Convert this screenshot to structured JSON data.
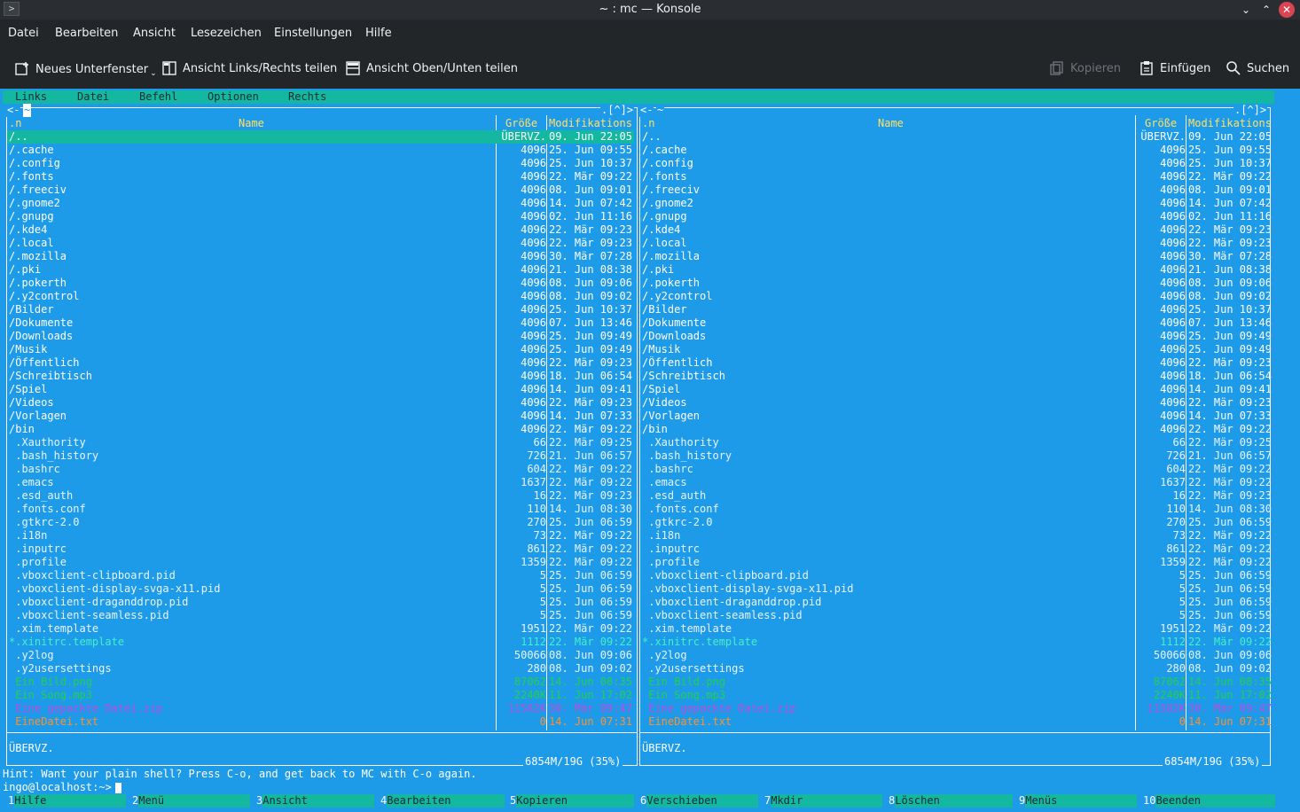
{
  "window": {
    "title": "~ : mc — Konsole",
    "app_icon": ">"
  },
  "menubar": [
    "Datei",
    "Bearbeiten",
    "Ansicht",
    "Lesezeichen",
    "Einstellungen",
    "Hilfe"
  ],
  "toolbar": {
    "new_tab": "Neues Unterfenster",
    "split_lr": "Ansicht Links/Rechts teilen",
    "split_tb": "Ansicht Oben/Unten teilen",
    "copy": "Kopieren",
    "paste": "Einfügen",
    "search": "Suchen"
  },
  "mc": {
    "menu": [
      "Links",
      "Datei",
      "Befehl",
      "Optionen",
      "Rechts"
    ],
    "columns": {
      "sort": ".n",
      "name": "Name",
      "size": "Größe",
      "date": "Modifikations"
    },
    "left_path": "~",
    "nav_left": "<-",
    "nav_right": ".[^]>",
    "status_selected": "ÜBERVZ.",
    "disk_info": "6854M/19G (35%)",
    "hint": "Hint: Want your plain shell? Press C-o, and get back to MC with C-o again.",
    "prompt": "ingo@localhost:~>",
    "files": [
      {
        "name": "/..",
        "size": "ÜBERVZ.",
        "date": "09. Jun 22:05",
        "type": "dir"
      },
      {
        "name": "/.cache",
        "size": "4096",
        "date": "25. Jun 09:55",
        "type": "dir"
      },
      {
        "name": "/.config",
        "size": "4096",
        "date": "25. Jun 10:37",
        "type": "dir"
      },
      {
        "name": "/.fonts",
        "size": "4096",
        "date": "22. Mär 09:22",
        "type": "dir"
      },
      {
        "name": "/.freeciv",
        "size": "4096",
        "date": "08. Jun 09:01",
        "type": "dir"
      },
      {
        "name": "/.gnome2",
        "size": "4096",
        "date": "14. Jun 07:42",
        "type": "dir"
      },
      {
        "name": "/.gnupg",
        "size": "4096",
        "date": "02. Jun 11:16",
        "type": "dir"
      },
      {
        "name": "/.kde4",
        "size": "4096",
        "date": "22. Mär 09:23",
        "type": "dir"
      },
      {
        "name": "/.local",
        "size": "4096",
        "date": "22. Mär 09:23",
        "type": "dir"
      },
      {
        "name": "/.mozilla",
        "size": "4096",
        "date": "30. Mär 07:28",
        "type": "dir"
      },
      {
        "name": "/.pki",
        "size": "4096",
        "date": "21. Jun 08:38",
        "type": "dir"
      },
      {
        "name": "/.pokerth",
        "size": "4096",
        "date": "08. Jun 09:06",
        "type": "dir"
      },
      {
        "name": "/.y2control",
        "size": "4096",
        "date": "08. Jun 09:02",
        "type": "dir"
      },
      {
        "name": "/Bilder",
        "size": "4096",
        "date": "25. Jun 10:37",
        "type": "dir"
      },
      {
        "name": "/Dokumente",
        "size": "4096",
        "date": "07. Jun 13:46",
        "type": "dir"
      },
      {
        "name": "/Downloads",
        "size": "4096",
        "date": "25. Jun 09:49",
        "type": "dir"
      },
      {
        "name": "/Musik",
        "size": "4096",
        "date": "25. Jun 09:49",
        "type": "dir"
      },
      {
        "name": "/Öffentlich",
        "size": "4096",
        "date": "22. Mär 09:23",
        "type": "dir"
      },
      {
        "name": "/Schreibtisch",
        "size": "4096",
        "date": "18. Jun 06:54",
        "type": "dir"
      },
      {
        "name": "/Spiel",
        "size": "4096",
        "date": "14. Jun 09:41",
        "type": "dir"
      },
      {
        "name": "/Videos",
        "size": "4096",
        "date": "22. Mär 09:23",
        "type": "dir"
      },
      {
        "name": "/Vorlagen",
        "size": "4096",
        "date": "14. Jun 07:33",
        "type": "dir"
      },
      {
        "name": "/bin",
        "size": "4096",
        "date": "22. Mär 09:22",
        "type": "dir"
      },
      {
        "name": " .Xauthority",
        "size": "66",
        "date": "22. Mär 09:25",
        "type": "file"
      },
      {
        "name": " .bash_history",
        "size": "726",
        "date": "21. Jun 06:57",
        "type": "file"
      },
      {
        "name": " .bashrc",
        "size": "604",
        "date": "22. Mär 09:22",
        "type": "file"
      },
      {
        "name": " .emacs",
        "size": "1637",
        "date": "22. Mär 09:22",
        "type": "file"
      },
      {
        "name": " .esd_auth",
        "size": "16",
        "date": "22. Mär 09:23",
        "type": "file"
      },
      {
        "name": " .fonts.conf",
        "size": "110",
        "date": "14. Jun 08:30",
        "type": "file"
      },
      {
        "name": " .gtkrc-2.0",
        "size": "270",
        "date": "25. Jun 06:59",
        "type": "file"
      },
      {
        "name": " .i18n",
        "size": "73",
        "date": "22. Mär 09:22",
        "type": "file"
      },
      {
        "name": " .inputrc",
        "size": "861",
        "date": "22. Mär 09:22",
        "type": "file"
      },
      {
        "name": " .profile",
        "size": "1359",
        "date": "22. Mär 09:22",
        "type": "file"
      },
      {
        "name": " .vboxclient-clipboard.pid",
        "size": "5",
        "date": "25. Jun 06:59",
        "type": "file"
      },
      {
        "name": " .vboxclient-display-svga-x11.pid",
        "size": "5",
        "date": "25. Jun 06:59",
        "type": "file"
      },
      {
        "name": " .vboxclient-draganddrop.pid",
        "size": "5",
        "date": "25. Jun 06:59",
        "type": "file"
      },
      {
        "name": " .vboxclient-seamless.pid",
        "size": "5",
        "date": "25. Jun 06:59",
        "type": "file"
      },
      {
        "name": " .xim.template",
        "size": "1951",
        "date": "22. Mär 09:22",
        "type": "file"
      },
      {
        "name": "*.xinitrc.template",
        "size": "1112",
        "date": "22. Mär 09:22",
        "type": "exe"
      },
      {
        "name": " .y2log",
        "size": "50066",
        "date": "08. Jun 09:06",
        "type": "file"
      },
      {
        "name": " .y2usersettings",
        "size": "280",
        "date": "08. Jun 09:02",
        "type": "file"
      },
      {
        "name": " Ein Bild.png",
        "size": "87062",
        "date": "14. Jun 08:35",
        "type": "img"
      },
      {
        "name": " Ein Song.mp3",
        "size": "2240K",
        "date": "11. Jun 17:02",
        "type": "snd"
      },
      {
        "name": " Eine gepackte Datei.zip",
        "size": "11582K",
        "date": "30. Mär 09:47",
        "type": "arc"
      },
      {
        "name": " EineDatei.txt",
        "size": "0",
        "date": "14. Jun 07:31",
        "type": "txt"
      }
    ],
    "fkeys": [
      {
        "num": "1",
        "label": "Hilfe"
      },
      {
        "num": "2",
        "label": "Menü"
      },
      {
        "num": "3",
        "label": "Ansicht"
      },
      {
        "num": "4",
        "label": "Bearbeiten"
      },
      {
        "num": "5",
        "label": "Kopieren"
      },
      {
        "num": "6",
        "label": "Verschieben"
      },
      {
        "num": "7",
        "label": "Mkdir"
      },
      {
        "num": "8",
        "label": "Löschen"
      },
      {
        "num": "9",
        "label": "Menüs"
      },
      {
        "num": "10",
        "label": "Beenden"
      }
    ]
  },
  "colors": {
    "terminal_bg": "#1e9be8",
    "accent_bar": "#14b8a0",
    "window_bg": "#232629",
    "close_button": "#da4453"
  }
}
